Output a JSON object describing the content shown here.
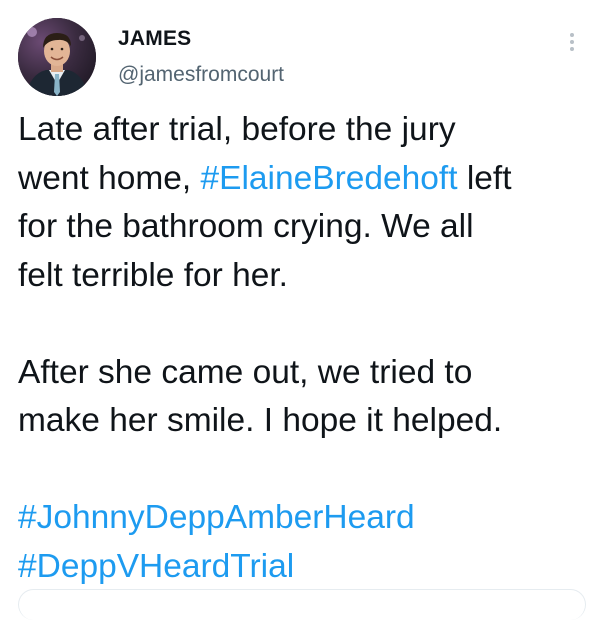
{
  "author": {
    "display_name": "JAMES",
    "handle": "@jamesfromcourt"
  },
  "more_icon": "more-vertical-icon",
  "tweet": {
    "line1": "Late after trial, before the jury",
    "line2_before": "went home, ",
    "line2_hashtag": "#ElaineBredehoft",
    "line2_after": " left",
    "line3": "for the bathroom crying. We all",
    "line4": "felt terrible for her.",
    "line5": "After she came out, we tried to",
    "line6": "make her smile. I hope it helped.",
    "hashtag1": "#JohnnyDeppAmberHeard",
    "hashtag2": "#DeppVHeardTrial"
  },
  "colors": {
    "text": "#0f1419",
    "secondary": "#536471",
    "link": "#1d9bf0"
  }
}
